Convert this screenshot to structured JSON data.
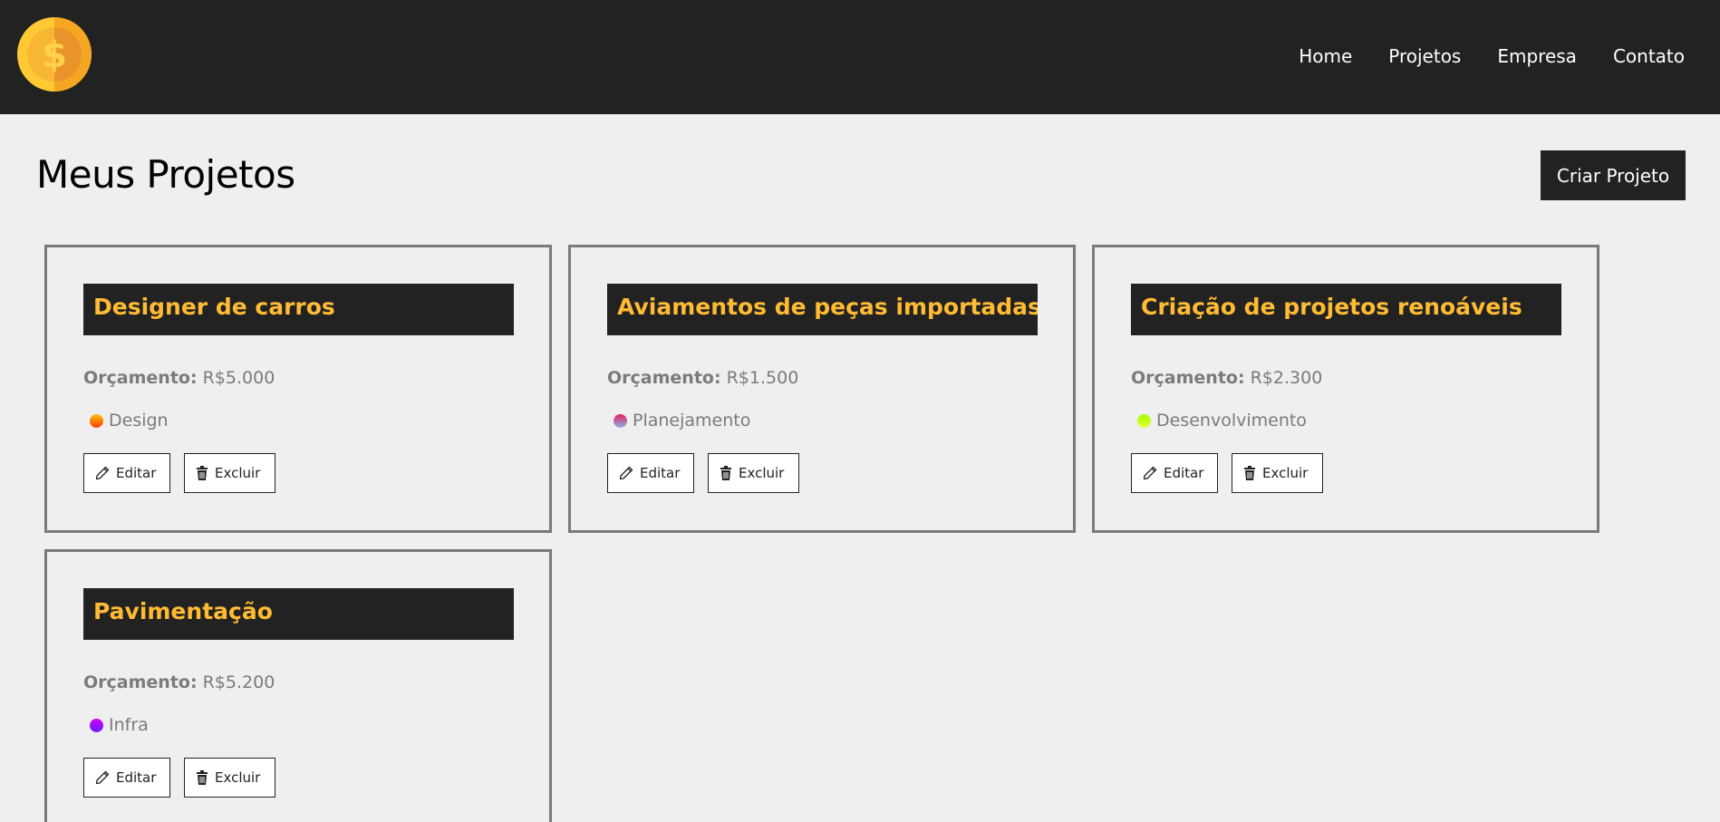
{
  "nav": {
    "logo_icon": "coin-dollar-icon",
    "links": [
      "Home",
      "Projetos",
      "Empresa",
      "Contato"
    ]
  },
  "header": {
    "title": "Meus Projetos",
    "create_label": "Criar Projeto"
  },
  "labels": {
    "budget": "Orçamento:",
    "edit": "Editar",
    "delete": "Excluir",
    "edit_icon": "pencil-icon",
    "delete_icon": "trash-icon"
  },
  "projects": [
    {
      "title": "Designer de carros",
      "budget": "R$5.000",
      "category": "Design",
      "color_a": "#ffc107",
      "color_b": "#ff3d00"
    },
    {
      "title": "Aviamentos de peças importadas",
      "budget": "R$1.500",
      "category": "Planejamento",
      "color_a": "#e91e63",
      "color_b": "#8ab4e8"
    },
    {
      "title": "Criação de projetos renoáveis",
      "budget": "R$2.300",
      "category": "Desenvolvimento",
      "color_a": "#a4ff00",
      "color_b": "#e6ff33"
    },
    {
      "title": "Pavimentação",
      "budget": "R$5.200",
      "category": "Infra",
      "color_a": "#d500f9",
      "color_b": "#651fff"
    }
  ],
  "colors": {
    "navbar": "#222222",
    "accent": "#ffbb33",
    "background": "#efefef"
  }
}
